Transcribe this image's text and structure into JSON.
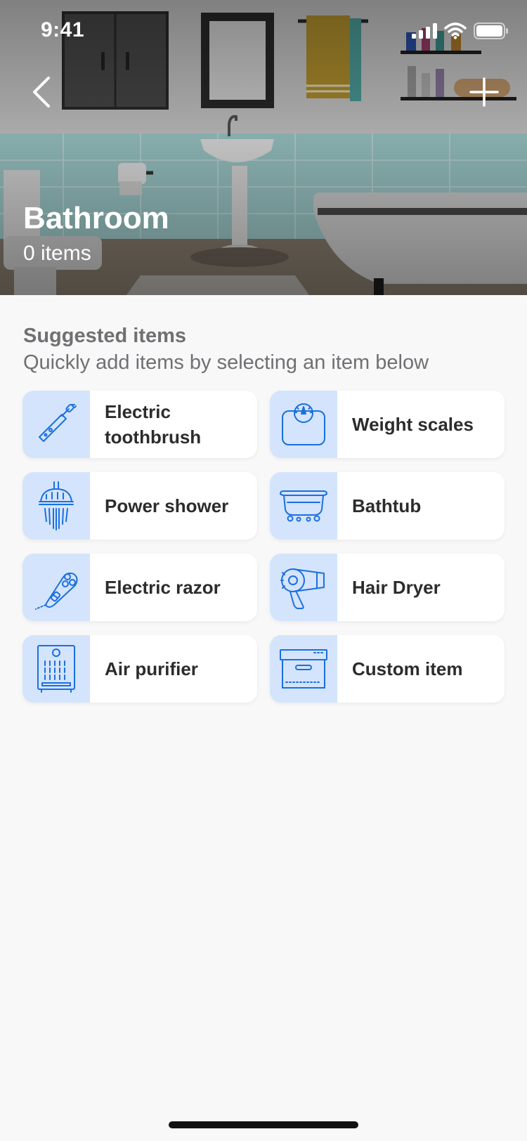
{
  "status_bar": {
    "time": "9:41"
  },
  "header": {
    "title": "Bathroom",
    "item_count": "0 items",
    "back_icon": "chevron-left-icon",
    "add_icon": "plus-icon"
  },
  "suggested": {
    "title": "Suggested items",
    "subtitle": "Quickly add items by selecting an item below",
    "items": [
      {
        "label": "Electric toothbrush",
        "icon": "electric-toothbrush-icon"
      },
      {
        "label": "Weight scales",
        "icon": "weight-scales-icon"
      },
      {
        "label": "Power shower",
        "icon": "power-shower-icon"
      },
      {
        "label": "Bathtub",
        "icon": "bathtub-icon"
      },
      {
        "label": "Electric razor",
        "icon": "electric-razor-icon"
      },
      {
        "label": "Hair Dryer",
        "icon": "hair-dryer-icon"
      },
      {
        "label": "Air purifier",
        "icon": "air-purifier-icon"
      },
      {
        "label": "Custom item",
        "icon": "box-icon"
      }
    ]
  },
  "colors": {
    "accent": "#1a6fe0",
    "icon_tile": "#d4e4fc",
    "background": "#f8f8f8",
    "text_secondary": "#707074"
  }
}
